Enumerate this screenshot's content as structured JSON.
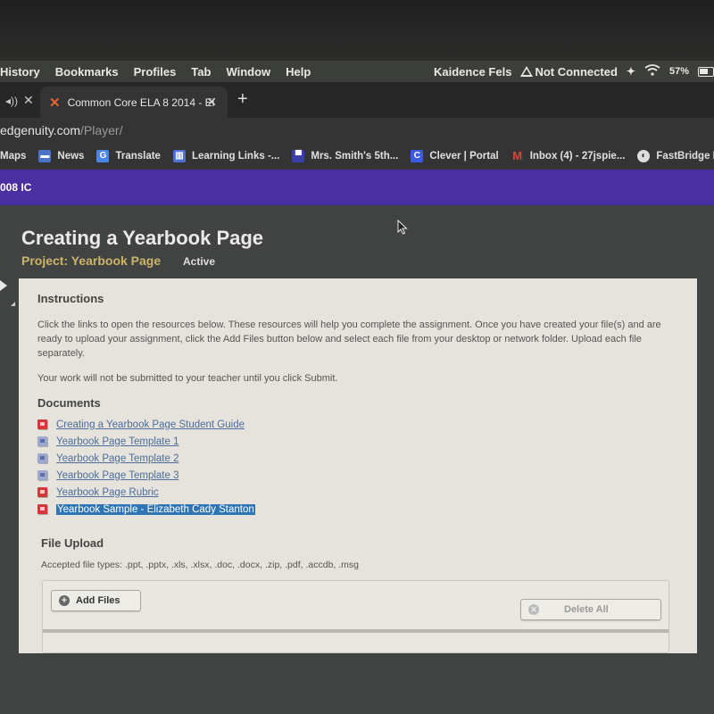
{
  "menubar": {
    "items": [
      "History",
      "Bookmarks",
      "Profiles",
      "Tab",
      "Window",
      "Help"
    ],
    "user": "Kaidence Fels",
    "network_status": "Not Connected",
    "battery": "57%"
  },
  "tabs": {
    "active_tab_title": "Common Core ELA 8 2014 - El",
    "new_tab_label": "+"
  },
  "address": {
    "domain": "edgenuity.com",
    "path": "/Player/"
  },
  "bookmarks": [
    {
      "label": "Maps",
      "icon": "maps-icon"
    },
    {
      "label": "News",
      "icon": "news-icon"
    },
    {
      "label": "Translate",
      "icon": "translate-icon"
    },
    {
      "label": "Learning Links -...",
      "icon": "learning-links-icon"
    },
    {
      "label": "Mrs. Smith's 5th...",
      "icon": "classroom-icon"
    },
    {
      "label": "Clever | Portal",
      "icon": "clever-icon"
    },
    {
      "label": "Inbox (4) - 27jspie...",
      "icon": "gmail-icon"
    },
    {
      "label": "FastBridge Learni...",
      "icon": "globe-icon"
    }
  ],
  "course_bar": {
    "label": "008 IC"
  },
  "page": {
    "title": "Creating a Yearbook Page",
    "subtitle": "Project: Yearbook Page",
    "status": "Active"
  },
  "instructions": {
    "heading": "Instructions",
    "paragraph1": "Click the links to open the resources below. These resources will help you complete the assignment. Once you have created your file(s) and are ready to upload your assignment, click the Add Files button below and select each file from your desktop or network folder. Upload each file separately.",
    "paragraph2": "Your work will not be submitted to your teacher until you click Submit."
  },
  "documents": {
    "heading": "Documents",
    "items": [
      {
        "label": "Creating a Yearbook Page Student Guide",
        "type": "pdf",
        "selected": false
      },
      {
        "label": "Yearbook Page Template 1",
        "type": "word",
        "selected": false
      },
      {
        "label": "Yearbook Page Template 2",
        "type": "word",
        "selected": false
      },
      {
        "label": "Yearbook Page Template 3",
        "type": "word",
        "selected": false
      },
      {
        "label": "Yearbook Page Rubric",
        "type": "pdf",
        "selected": false
      },
      {
        "label": "Yearbook Sample - Elizabeth Cady Stanton",
        "type": "pdf",
        "selected": true
      }
    ]
  },
  "file_upload": {
    "heading": "File Upload",
    "accepted_types": "Accepted file types: .ppt, .pptx, .xls, .xlsx, .doc, .docx, .zip, .pdf, .accdb, .msg",
    "add_files_label": "Add Files",
    "delete_all_label": "Delete All"
  }
}
